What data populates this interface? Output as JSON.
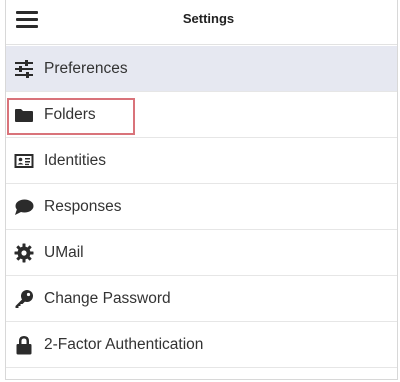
{
  "header": {
    "title": "Settings",
    "menu_icon": "hamburger-menu-icon"
  },
  "settings_list": {
    "items": [
      {
        "label": "Preferences",
        "icon": "sliders-icon",
        "active": true
      },
      {
        "label": "Folders",
        "icon": "folder-icon",
        "active": false,
        "highlighted": true
      },
      {
        "label": "Identities",
        "icon": "id-card-icon",
        "active": false
      },
      {
        "label": "Responses",
        "icon": "speech-bubble-icon",
        "active": false
      },
      {
        "label": "UMail",
        "icon": "gear-icon",
        "active": false
      },
      {
        "label": "Change Password",
        "icon": "key-icon",
        "active": false
      },
      {
        "label": "2-Factor Authentication",
        "icon": "lock-icon",
        "active": false
      }
    ]
  },
  "colors": {
    "active_row_bg": "#e6e8f1",
    "highlight_border": "#d9737a",
    "icon_color": "#2b2b2b"
  }
}
